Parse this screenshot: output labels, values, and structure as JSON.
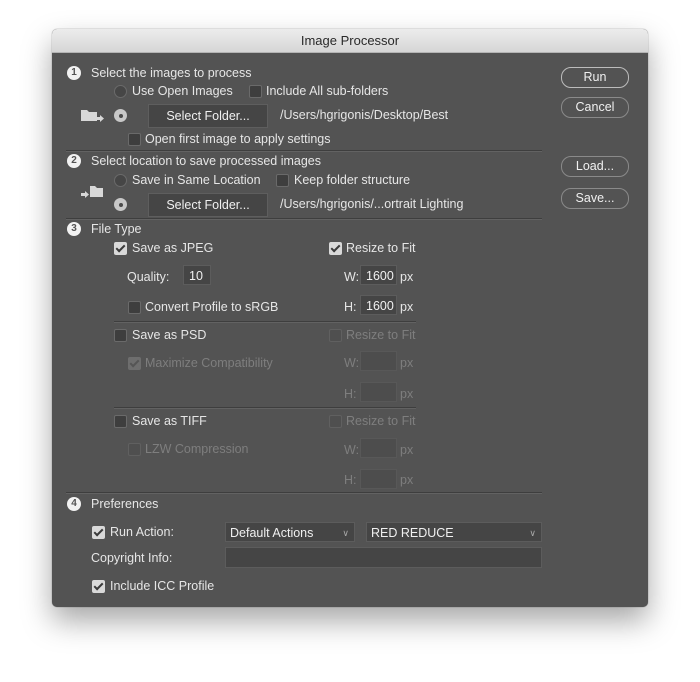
{
  "window": {
    "title": "Image Processor"
  },
  "buttons": {
    "run": "Run",
    "cancel": "Cancel",
    "load": "Load...",
    "save": "Save..."
  },
  "section1": {
    "number": "1",
    "title": "Select the images to process",
    "use_open_images": {
      "label": "Use Open Images",
      "selected": false
    },
    "include_subfolders": {
      "label": "Include All sub-folders",
      "checked": false
    },
    "select_folder_button": "Select Folder...",
    "folder_path": "/Users/hgrigonis/Desktop/Best",
    "folder_radio_selected": true,
    "open_first_image": {
      "label": "Open first image to apply settings",
      "checked": false
    }
  },
  "section2": {
    "number": "2",
    "title": "Select location to save processed images",
    "save_same_location": {
      "label": "Save in Same Location",
      "selected": false
    },
    "keep_folder_structure": {
      "label": "Keep folder structure",
      "checked": false
    },
    "select_folder_button": "Select Folder...",
    "folder_path": "/Users/hgrigonis/...ortrait Lighting",
    "folder_radio_selected": true
  },
  "section3": {
    "number": "3",
    "title": "File Type",
    "jpeg": {
      "label": "Save as JPEG",
      "checked": true,
      "quality_label": "Quality:",
      "quality_value": "10",
      "convert_profile": {
        "label": "Convert Profile to sRGB",
        "checked": false
      },
      "resize": {
        "label": "Resize to Fit",
        "checked": true
      },
      "w_label": "W:",
      "w_value": "1600",
      "h_label": "H:",
      "h_value": "1600",
      "unit": "px"
    },
    "psd": {
      "label": "Save as PSD",
      "checked": false,
      "maximize": {
        "label": "Maximize Compatibility",
        "checked": true,
        "disabled": true
      },
      "resize": {
        "label": "Resize to Fit",
        "checked": false,
        "disabled": true
      },
      "w_label": "W:",
      "w_value": "",
      "h_label": "H:",
      "h_value": "",
      "unit": "px"
    },
    "tiff": {
      "label": "Save as TIFF",
      "checked": false,
      "lzw": {
        "label": "LZW Compression",
        "checked": false,
        "disabled": true
      },
      "resize": {
        "label": "Resize to Fit",
        "checked": false,
        "disabled": true
      },
      "w_label": "W:",
      "w_value": "",
      "h_label": "H:",
      "h_value": "",
      "unit": "px"
    }
  },
  "section4": {
    "number": "4",
    "title": "Preferences",
    "run_action": {
      "label": "Run Action:",
      "checked": true,
      "set": "Default Actions",
      "action": "RED REDUCE"
    },
    "copyright": {
      "label": "Copyright Info:",
      "value": ""
    },
    "icc": {
      "label": "Include ICC Profile",
      "checked": true
    }
  }
}
